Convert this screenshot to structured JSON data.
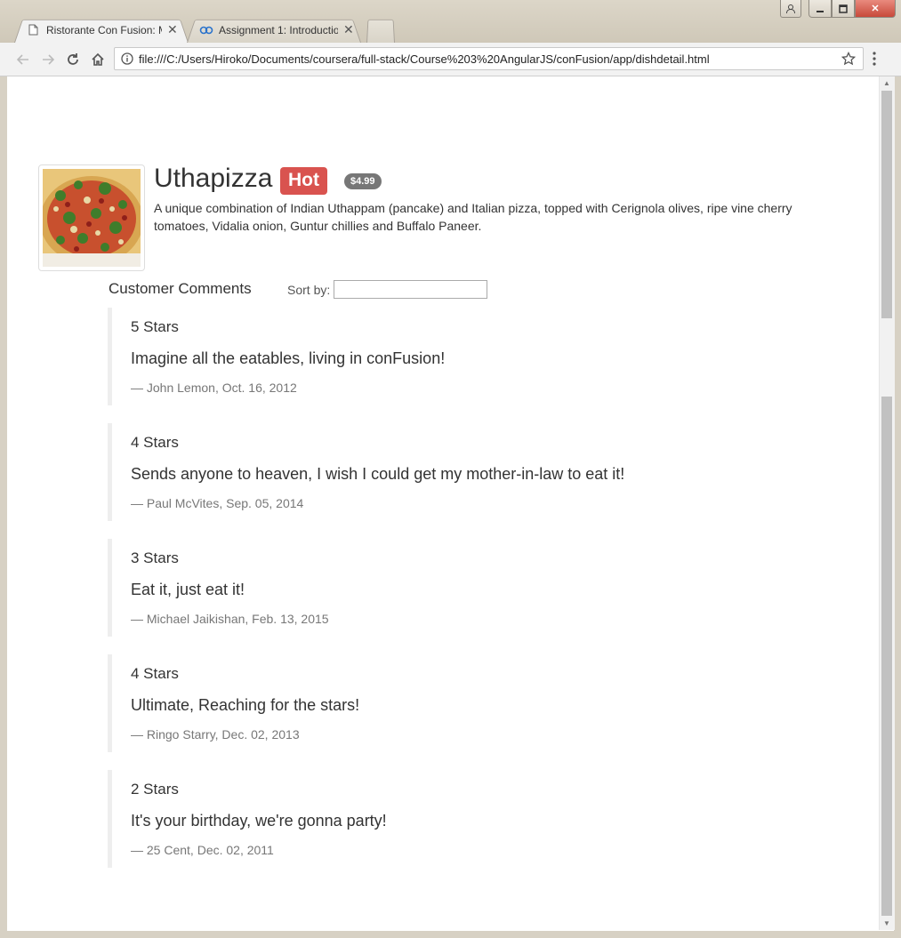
{
  "browser": {
    "tabs": [
      {
        "title": "Ristorante Con Fusion: M",
        "icon": "page-icon",
        "active": true
      },
      {
        "title": "Assignment 1: Introductio",
        "icon": "coursera-icon",
        "active": false
      }
    ],
    "url": "file:///C:/Users/Hiroko/Documents/coursera/full-stack/Course%203%20AngularJS/conFusion/app/dishdetail.html"
  },
  "dish": {
    "name": "Uthapizza",
    "label": "Hot",
    "price": "$4.99",
    "description": "A unique combination of Indian Uthappam (pancake) and Italian pizza, topped with Cerignola olives, ripe vine cherry tomatoes, Vidalia onion, Guntur chillies and Buffalo Paneer.",
    "image_alt": "Uthapizza"
  },
  "comments_section": {
    "heading": "Customer Comments",
    "sort_label": "Sort by:",
    "sort_value": ""
  },
  "comments": [
    {
      "rating": "5 Stars",
      "text": "Imagine all the eatables, living in conFusion!",
      "footer": "— John Lemon, Oct. 16, 2012"
    },
    {
      "rating": "4 Stars",
      "text": "Sends anyone to heaven, I wish I could get my mother-in-law to eat it!",
      "footer": "— Paul McVites, Sep. 05, 2014"
    },
    {
      "rating": "3 Stars",
      "text": "Eat it, just eat it!",
      "footer": "— Michael Jaikishan, Feb. 13, 2015"
    },
    {
      "rating": "4 Stars",
      "text": "Ultimate, Reaching for the stars!",
      "footer": "— Ringo Starry, Dec. 02, 2013"
    },
    {
      "rating": "2 Stars",
      "text": "It's your birthday, we're gonna party!",
      "footer": "— 25 Cent, Dec. 02, 2011"
    }
  ],
  "colors": {
    "hot": "#d9534f",
    "badge": "#777777",
    "text": "#333333",
    "muted": "#777777"
  }
}
